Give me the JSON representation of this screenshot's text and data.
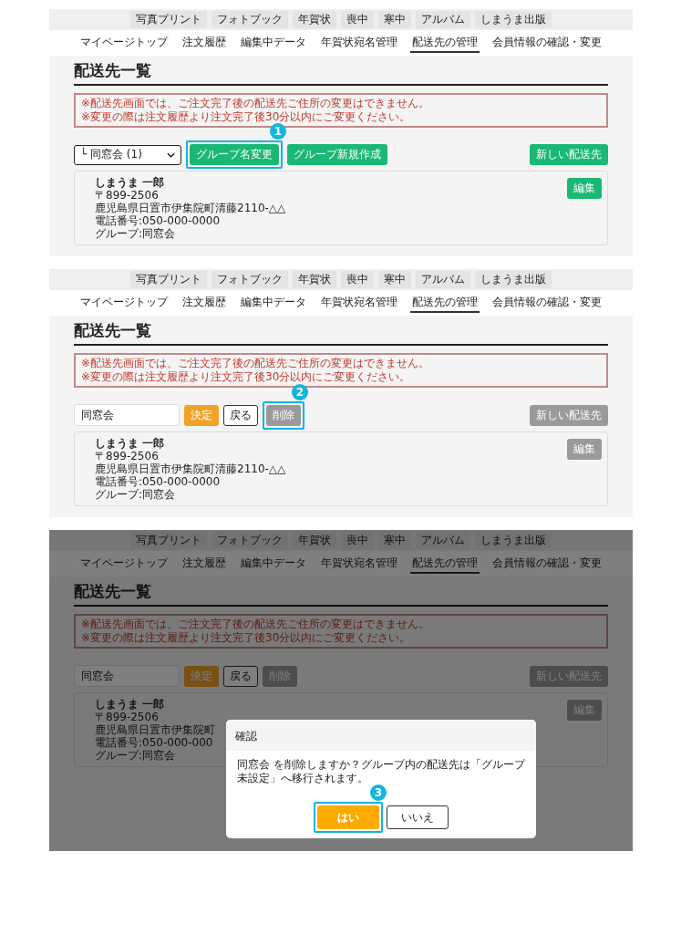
{
  "panels": [
    {
      "step": "1",
      "dimmed": false,
      "category_tabs": [
        "写真プリント",
        "フォトブック",
        "年賀状",
        "喪中",
        "寒中",
        "アルバム",
        "しまうま出版"
      ],
      "nav": [
        {
          "label": "マイページトップ",
          "selected": false
        },
        {
          "label": "注文履歴",
          "selected": false
        },
        {
          "label": "編集中データ",
          "selected": false
        },
        {
          "label": "年賀状宛名管理",
          "selected": false
        },
        {
          "label": "配送先の管理",
          "selected": true
        },
        {
          "label": "会員情報の確認・変更",
          "selected": false
        }
      ],
      "title": "配送先一覧",
      "notice": [
        "※配送先画面では、ご注文完了後の配送先ご住所の変更はできません。",
        "※変更の際は注文履歴より注文完了後30分以内にご変更ください。"
      ],
      "controls": [
        {
          "kind": "select",
          "value": "└ 同窓会 (1)",
          "highlighted": false
        },
        {
          "kind": "primary",
          "label": "グループ名変更",
          "highlighted": true
        },
        {
          "kind": "primary",
          "label": "グループ新規作成",
          "highlighted": false
        }
      ],
      "new_button": {
        "label": "新しい配送先",
        "disabled": false
      },
      "card": {
        "name": "しまうま 一郎",
        "postal": "〒899-2506",
        "address": "鹿児島県日置市伊集院町清藤2110-△△",
        "phone": "電話番号:050-000-0000",
        "group": "グループ:同窓会",
        "edit": {
          "label": "編集",
          "disabled": false
        }
      }
    },
    {
      "step": "2",
      "dimmed": false,
      "category_tabs": [
        "写真プリント",
        "フォトブック",
        "年賀状",
        "喪中",
        "寒中",
        "アルバム",
        "しまうま出版"
      ],
      "nav": [
        {
          "label": "マイページトップ",
          "selected": false
        },
        {
          "label": "注文履歴",
          "selected": false
        },
        {
          "label": "編集中データ",
          "selected": false
        },
        {
          "label": "年賀状宛名管理",
          "selected": false
        },
        {
          "label": "配送先の管理",
          "selected": true
        },
        {
          "label": "会員情報の確認・変更",
          "selected": false
        }
      ],
      "title": "配送先一覧",
      "notice": [
        "※配送先画面では、ご注文完了後の配送先ご住所の変更はできません。",
        "※変更の際は注文履歴より注文完了後30分以内にご変更ください。"
      ],
      "controls": [
        {
          "kind": "input",
          "value": "同窓会",
          "highlighted": false
        },
        {
          "kind": "confirm",
          "label": "決定",
          "highlighted": false
        },
        {
          "kind": "back",
          "label": "戻る",
          "highlighted": false
        },
        {
          "kind": "delete",
          "label": "削除",
          "highlighted": true
        }
      ],
      "new_button": {
        "label": "新しい配送先",
        "disabled": true
      },
      "card": {
        "name": "しまうま 一郎",
        "postal": "〒899-2506",
        "address": "鹿児島県日置市伊集院町清藤2110-△△",
        "phone": "電話番号:050-000-0000",
        "group": "グループ:同窓会",
        "edit": {
          "label": "編集",
          "disabled": true
        }
      }
    },
    {
      "step": "3",
      "dimmed": true,
      "category_tabs": [
        "写真プリント",
        "フォトブック",
        "年賀状",
        "喪中",
        "寒中",
        "アルバム",
        "しまうま出版"
      ],
      "nav": [
        {
          "label": "マイページトップ",
          "selected": false
        },
        {
          "label": "注文履歴",
          "selected": false
        },
        {
          "label": "編集中データ",
          "selected": false
        },
        {
          "label": "年賀状宛名管理",
          "selected": false
        },
        {
          "label": "配送先の管理",
          "selected": true
        },
        {
          "label": "会員情報の確認・変更",
          "selected": false
        }
      ],
      "title": "配送先一覧",
      "notice": [
        "※配送先画面では、ご注文完了後の配送先ご住所の変更はできません。",
        "※変更の際は注文履歴より注文完了後30分以内にご変更ください。"
      ],
      "controls": [
        {
          "kind": "input",
          "value": "同窓会",
          "highlighted": false
        },
        {
          "kind": "confirm",
          "label": "決定",
          "highlighted": false
        },
        {
          "kind": "back",
          "label": "戻る",
          "highlighted": false
        },
        {
          "kind": "delete",
          "label": "削除",
          "highlighted": false
        }
      ],
      "new_button": {
        "label": "新しい配送先",
        "disabled": true
      },
      "card": {
        "name": "しまうま 一郎",
        "postal": "〒899-2506",
        "address": "鹿児島県日置市伊集院町",
        "phone": "電話番号:050-000-000",
        "group": "グループ:同窓会",
        "edit": {
          "label": "編集",
          "disabled": true
        }
      },
      "dialog": {
        "title": "確認",
        "message": "同窓会 を削除しますか？グループ内の配送先は「グループ未設定」へ移行されます。",
        "buttons": [
          {
            "kind": "yes",
            "label": "はい",
            "highlighted": true
          },
          {
            "kind": "no",
            "label": "いいえ",
            "highlighted": false
          }
        ]
      }
    }
  ]
}
